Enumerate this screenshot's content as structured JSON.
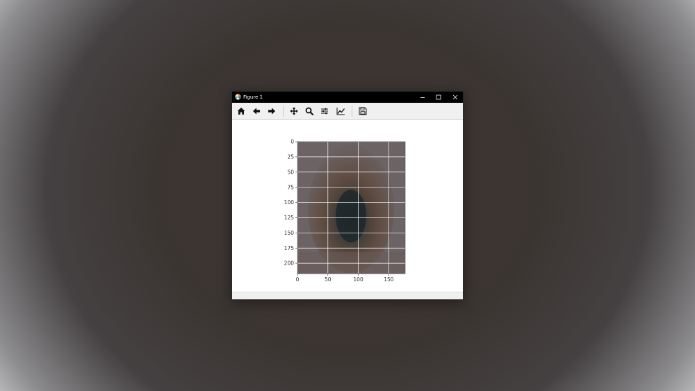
{
  "window": {
    "title": "Figure 1"
  },
  "toolbar": {
    "buttons": [
      {
        "name": "home-icon"
      },
      {
        "name": "back-arrow-icon"
      },
      {
        "name": "forward-arrow-icon"
      },
      {
        "name": "pan-icon"
      },
      {
        "name": "zoom-icon"
      },
      {
        "name": "configure-subplots-icon"
      },
      {
        "name": "edit-axis-icon"
      },
      {
        "name": "save-icon"
      }
    ]
  },
  "chart_data": {
    "type": "image",
    "grid": true,
    "x_ticks": [
      "0",
      "50",
      "100",
      "150"
    ],
    "y_ticks": [
      "0",
      "25",
      "50",
      "75",
      "100",
      "125",
      "150",
      "175",
      "200"
    ],
    "xlim": [
      0,
      177
    ],
    "ylim": [
      217,
      0
    ]
  }
}
